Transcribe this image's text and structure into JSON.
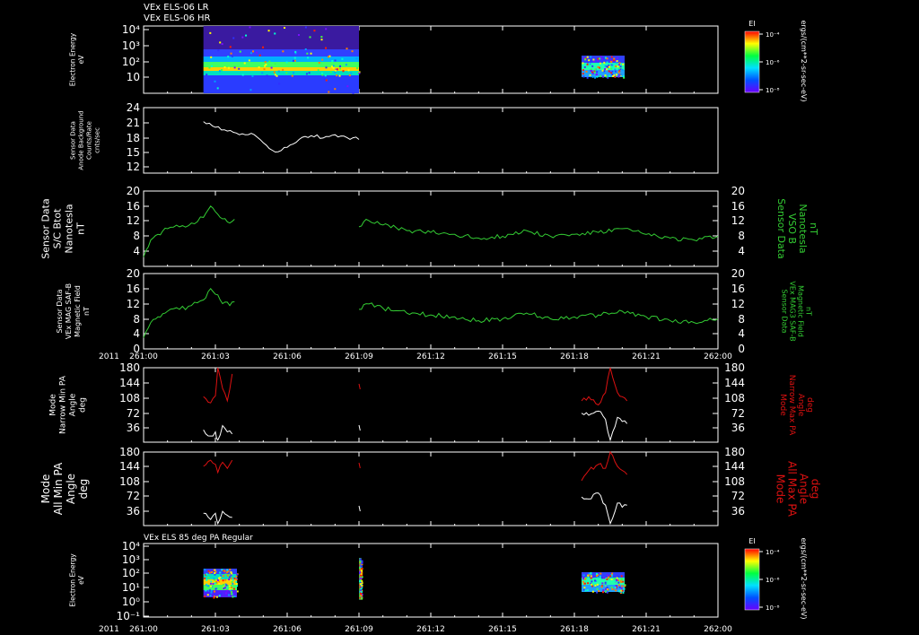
{
  "header": {
    "line1": "VEx ELS-06 LR",
    "line2": "VEx ELS-06 HR"
  },
  "colors": {
    "background": "#000000",
    "axes": "#ffffff",
    "bfield": "#33cc33",
    "pa_max": "#dd1111",
    "pa_min": "#ffffff"
  },
  "time_axis": {
    "year_label": "2011",
    "ticks": [
      "261:00",
      "261:03",
      "261:06",
      "261:09",
      "261:12",
      "261:15",
      "261:18",
      "261:21",
      "262:00"
    ],
    "start_min": 0,
    "end_min": 24,
    "tick_step_min": 3
  },
  "colorbar": {
    "title": "EI",
    "units": "ergs/(cm**2-sr-sec-eV)",
    "tick_labels": [
      "10⁻⁴",
      "10⁻⁶",
      "10⁻⁸"
    ]
  },
  "panels": {
    "spec_top": {
      "ylabel_lines": [
        "Electron Energy",
        "eV"
      ],
      "ytick_labels": [
        "10⁴",
        "10³",
        "10²",
        "10"
      ]
    },
    "anode": {
      "ylabel_lines": [
        "Sensor Data",
        "Anode Background",
        "Counts/Rate",
        "cnts/sec"
      ],
      "ytick_labels": [
        "24",
        "21",
        "18",
        "15",
        "12"
      ]
    },
    "btot": {
      "ylabel_lines": [
        "Sensor Data",
        "S/C Btot",
        "Nanotesla",
        "nT"
      ],
      "ytick_labels": [
        "20",
        "16",
        "12",
        "8",
        "4"
      ],
      "right_label_lines": [
        "Sensor Data",
        "VSO B",
        "Nanotesla",
        "nT"
      ],
      "right_tick_labels": [
        "20",
        "16",
        "12",
        "8",
        "4"
      ]
    },
    "mag": {
      "ylabel_lines": [
        "Sensor Data",
        "VEx MAG SAF-B",
        "Magnetic Field",
        "nT"
      ],
      "ytick_labels": [
        "20",
        "16",
        "12",
        "8",
        "4",
        "0"
      ],
      "right_label_lines": [
        "Sensor Data",
        "VEx MAG3 SAF-B",
        "Magnetic Field",
        "nT"
      ],
      "right_tick_labels": [
        "20",
        "16",
        "12",
        "8",
        "4",
        "0"
      ]
    },
    "pa_narrow": {
      "ylabel_lines": [
        "Mode",
        "Narrow Min PA",
        "Angle",
        "deg"
      ],
      "ytick_labels": [
        "180",
        "144",
        "108",
        "72",
        "36"
      ],
      "right_label_lines": [
        "Mode",
        "Narrow Max PA",
        "Angle",
        "deg"
      ],
      "right_tick_labels": [
        "180",
        "144",
        "108",
        "72",
        "36"
      ]
    },
    "pa_all": {
      "ylabel_lines": [
        "Mode",
        "All Min PA",
        "Angle",
        "deg"
      ],
      "ytick_labels": [
        "180",
        "144",
        "108",
        "72",
        "36"
      ],
      "right_label_lines": [
        "Mode",
        "All Max PA",
        "Angle",
        "deg"
      ],
      "right_tick_labels": [
        "180",
        "144",
        "108",
        "72",
        "36"
      ]
    },
    "spec_bottom": {
      "title": "VEx ELS 85 deg PA Regular",
      "ylabel_lines": [
        "Electron Energy",
        "eV"
      ],
      "ytick_labels": [
        "10⁴",
        "10³",
        "10²",
        "10¹",
        "10⁰",
        "10⁻¹"
      ]
    }
  },
  "chart_data": [
    {
      "type": "heatmap",
      "name": "spec_top",
      "x_unit": "minutes after 261:00",
      "yscale": "log",
      "ylim": [
        1,
        15000
      ],
      "data_intervals": [
        [
          2.5,
          9.0
        ],
        [
          18.3,
          20.1
        ]
      ],
      "intensity_scale": "log10 EI, 1e-8 to 1e-4"
    },
    {
      "type": "line",
      "name": "anode",
      "ylim": [
        10,
        24
      ],
      "x": [
        2.5,
        3.0,
        3.5,
        4.0,
        4.5,
        5.0,
        5.5,
        6.0,
        6.5,
        7.0,
        7.5,
        8.0,
        8.5,
        9.0
      ],
      "values": [
        21,
        19.8,
        19,
        18.2,
        18.5,
        16.5,
        14.5,
        15.5,
        17.2,
        18,
        17.5,
        18.2,
        17.6,
        17.2
      ]
    },
    {
      "type": "line",
      "name": "btot",
      "ylim": [
        0,
        20
      ],
      "x": [
        0,
        0.3,
        0.6,
        1.0,
        1.5,
        2.0,
        2.5,
        2.8,
        3.0,
        3.2,
        3.6,
        3.8,
        9.0,
        9.3,
        10,
        11,
        12,
        13,
        14,
        15,
        16,
        17,
        18,
        19,
        20,
        21,
        22,
        23,
        24
      ],
      "values": [
        2.5,
        7,
        8.5,
        10,
        10.5,
        11.5,
        13,
        16,
        14.5,
        13,
        11.5,
        12.5,
        10.5,
        12.5,
        11,
        9.5,
        9,
        8.5,
        7.5,
        8,
        9.5,
        8,
        8.5,
        9,
        10,
        8.5,
        7.5,
        7,
        8
      ]
    },
    {
      "type": "line",
      "name": "mag",
      "ylim": [
        0,
        20
      ],
      "x": [
        0,
        0.3,
        0.6,
        1.0,
        1.5,
        2.0,
        2.5,
        2.8,
        3.0,
        3.2,
        3.6,
        3.8,
        9.0,
        9.3,
        10,
        11,
        12,
        13,
        14,
        15,
        16,
        17,
        18,
        19,
        20,
        21,
        22,
        23,
        24
      ],
      "values": [
        3,
        7,
        8.5,
        10,
        10.5,
        11.5,
        13,
        16,
        14.5,
        13,
        11.5,
        12.5,
        10.5,
        12,
        10.8,
        9.5,
        9,
        8.5,
        7.5,
        8,
        9.5,
        8,
        8.5,
        9,
        10,
        8.5,
        7.5,
        7,
        8
      ]
    },
    {
      "type": "line",
      "name": "pa_narrow",
      "ylim": [
        0,
        180
      ],
      "series": [
        {
          "x": [
            2.5,
            2.8,
            3.0,
            3.1,
            3.3,
            3.5,
            3.7,
            18.3,
            18.6,
            19.0,
            19.3,
            19.5,
            19.8,
            20.0,
            20.2
          ],
          "values": [
            110,
            95,
            112,
            180,
            130,
            100,
            165,
            100,
            110,
            90,
            120,
            180,
            120,
            110,
            100
          ]
        },
        {
          "x": [
            2.5,
            2.8,
            3.0,
            3.1,
            3.3,
            3.5,
            3.7,
            18.3,
            18.6,
            19.0,
            19.3,
            19.5,
            19.8,
            20.0,
            20.2
          ],
          "values": [
            30,
            15,
            25,
            5,
            40,
            25,
            20,
            70,
            65,
            75,
            55,
            5,
            60,
            50,
            45
          ]
        }
      ]
    },
    {
      "type": "line",
      "name": "pa_all",
      "ylim": [
        0,
        180
      ],
      "series": [
        {
          "x": [
            2.5,
            2.8,
            3.0,
            3.1,
            3.3,
            3.5,
            3.7,
            18.3,
            18.6,
            19.0,
            19.3,
            19.5,
            19.8,
            20.0,
            20.2
          ],
          "values": [
            145,
            160,
            150,
            130,
            155,
            140,
            160,
            110,
            135,
            150,
            140,
            180,
            145,
            135,
            125
          ]
        },
        {
          "x": [
            2.5,
            2.8,
            3.0,
            3.1,
            3.3,
            3.5,
            3.7,
            18.3,
            18.6,
            19.0,
            19.3,
            19.5,
            19.8,
            20.0,
            20.2
          ],
          "values": [
            30,
            15,
            30,
            5,
            35,
            25,
            20,
            70,
            65,
            80,
            50,
            5,
            55,
            45,
            50
          ]
        }
      ]
    },
    {
      "type": "heatmap",
      "name": "spec_bottom",
      "x_unit": "minutes after 261:00",
      "yscale": "log",
      "ylim": [
        0.1,
        15000
      ],
      "data_intervals": [
        [
          2.5,
          3.9
        ],
        [
          9.0,
          9.1
        ],
        [
          18.3,
          20.1
        ]
      ],
      "intensity_scale": "log10 EI, 1e-8 to 1e-4"
    }
  ]
}
